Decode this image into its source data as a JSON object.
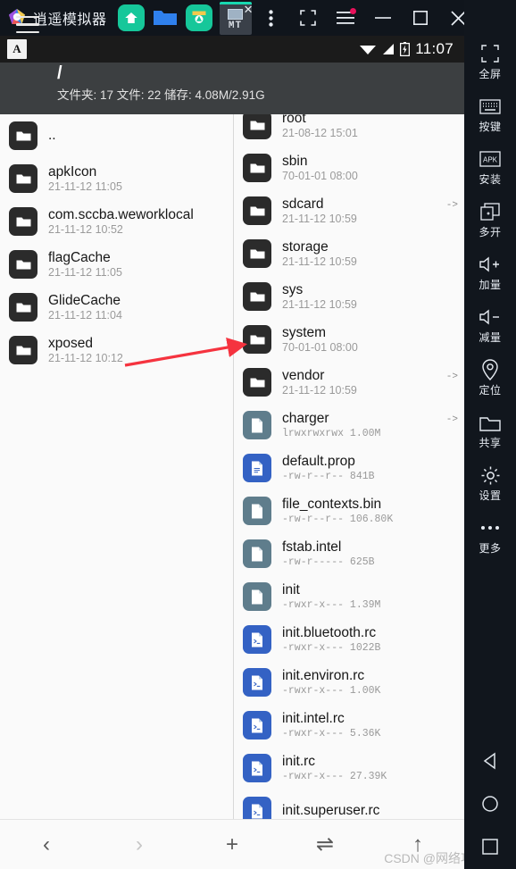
{
  "titlebar": {
    "app_name": "逍遥模拟器",
    "logo_icon": "memu-logo-icon",
    "apps": [
      {
        "name": "home-app-icon",
        "label": "",
        "style": "green"
      },
      {
        "name": "folder-app-icon",
        "label": "",
        "style": "blue"
      },
      {
        "name": "settings-app-icon",
        "label": "",
        "style": "green"
      },
      {
        "name": "mt-manager-tab",
        "label": "MT",
        "style": "active"
      }
    ],
    "controls": [
      {
        "name": "more-options-icon",
        "glyph": "⋮"
      },
      {
        "name": "screenshot-icon",
        "glyph": "screenshot"
      },
      {
        "name": "menu-icon",
        "glyph": "menu",
        "badge": true
      },
      {
        "name": "minimize-icon",
        "glyph": "minimize"
      },
      {
        "name": "maximize-icon",
        "glyph": "maximize"
      },
      {
        "name": "close-icon",
        "glyph": "close"
      },
      {
        "name": "collapse-sidebar-icon",
        "glyph": "«‹"
      }
    ]
  },
  "statusbar": {
    "ime_label": "A",
    "wifi_icon": "wifi-icon",
    "signal_icon": "signal-icon",
    "battery_icon": "battery-icon",
    "time": "11:07"
  },
  "app_header": {
    "menu_icon": "hamburger-menu-icon",
    "path": "/",
    "meta": "文件夹: 17  文件: 22  储存: 4.08M/2.91G",
    "overflow_icon": "kebab-menu-icon"
  },
  "left_pane": {
    "items": [
      {
        "name": "..",
        "sub": "",
        "type": "folder"
      },
      {
        "name": "apkIcon",
        "sub": "21-11-12 11:05",
        "type": "folder"
      },
      {
        "name": "com.sccba.weworklocal",
        "sub": "21-11-12 10:52",
        "type": "folder"
      },
      {
        "name": "flagCache",
        "sub": "21-11-12 11:05",
        "type": "folder"
      },
      {
        "name": "GlideCache",
        "sub": "21-11-12 11:04",
        "type": "folder"
      },
      {
        "name": "xposed",
        "sub": "21-11-12 10:12",
        "type": "folder"
      }
    ]
  },
  "right_pane": {
    "items": [
      {
        "name": "root",
        "sub": "21-08-12 15:01",
        "type": "folder",
        "link": ""
      },
      {
        "name": "sbin",
        "sub": "70-01-01 08:00",
        "type": "folder",
        "link": ""
      },
      {
        "name": "sdcard",
        "sub": "21-11-12 10:59",
        "type": "folder",
        "link": "->"
      },
      {
        "name": "storage",
        "sub": "21-11-12 10:59",
        "type": "folder",
        "link": ""
      },
      {
        "name": "sys",
        "sub": "21-11-12 10:59",
        "type": "folder",
        "link": ""
      },
      {
        "name": "system",
        "sub": "70-01-01 08:00",
        "type": "folder",
        "link": ""
      },
      {
        "name": "vendor",
        "sub": "21-11-12 10:59",
        "type": "folder",
        "link": "->"
      },
      {
        "name": "charger",
        "sub": "lrwxrwxrwx 1.00M",
        "type": "file-gray",
        "link": "->"
      },
      {
        "name": "default.prop",
        "sub": "-rw-r--r-- 841B",
        "type": "file-blue",
        "link": ""
      },
      {
        "name": "file_contexts.bin",
        "sub": "-rw-r--r-- 106.80K",
        "type": "file-gray",
        "link": ""
      },
      {
        "name": "fstab.intel",
        "sub": "-rw-r----- 625B",
        "type": "file-gray",
        "link": ""
      },
      {
        "name": "init",
        "sub": "-rwxr-x--- 1.39M",
        "type": "file-gray",
        "link": ""
      },
      {
        "name": "init.bluetooth.rc",
        "sub": "-rwxr-x--- 1022B",
        "type": "file-blue",
        "link": ""
      },
      {
        "name": "init.environ.rc",
        "sub": "-rwxr-x--- 1.00K",
        "type": "file-blue",
        "link": ""
      },
      {
        "name": "init.intel.rc",
        "sub": "-rwxr-x--- 5.36K",
        "type": "file-blue",
        "link": ""
      },
      {
        "name": "init.rc",
        "sub": "-rwxr-x--- 27.39K",
        "type": "file-blue",
        "link": ""
      },
      {
        "name": "init.superuser.rc",
        "sub": "",
        "type": "file-blue",
        "link": ""
      }
    ]
  },
  "bottom_toolbar": {
    "buttons": [
      {
        "name": "back-button",
        "glyph": "‹",
        "enabled": true
      },
      {
        "name": "forward-button",
        "glyph": "›",
        "enabled": false
      },
      {
        "name": "add-button",
        "glyph": "+",
        "enabled": true
      },
      {
        "name": "swap-panes-button",
        "glyph": "⇌",
        "enabled": true
      },
      {
        "name": "up-directory-button",
        "glyph": "↑",
        "enabled": true
      }
    ],
    "watermark": "CSDN @网络攻城狮、"
  },
  "sidebar": {
    "items": [
      {
        "icon": "fullscreen-icon",
        "label": "全屏"
      },
      {
        "icon": "keyboard-icon",
        "label": "按键"
      },
      {
        "icon": "apk-install-icon",
        "label": "安装"
      },
      {
        "icon": "multi-window-icon",
        "label": "多开"
      },
      {
        "icon": "volume-up-icon",
        "label": "加量"
      },
      {
        "icon": "volume-down-icon",
        "label": "减量"
      },
      {
        "icon": "location-icon",
        "label": "定位"
      },
      {
        "icon": "shared-folder-icon",
        "label": "共享"
      },
      {
        "icon": "settings-gear-icon",
        "label": "设置"
      },
      {
        "icon": "more-dots-icon",
        "label": "更多"
      }
    ],
    "nav": [
      {
        "icon": "android-back-icon"
      },
      {
        "icon": "android-home-icon"
      },
      {
        "icon": "android-recents-icon"
      }
    ]
  },
  "annotation": {
    "arrow_color": "#f5333f",
    "points_to": "system"
  }
}
